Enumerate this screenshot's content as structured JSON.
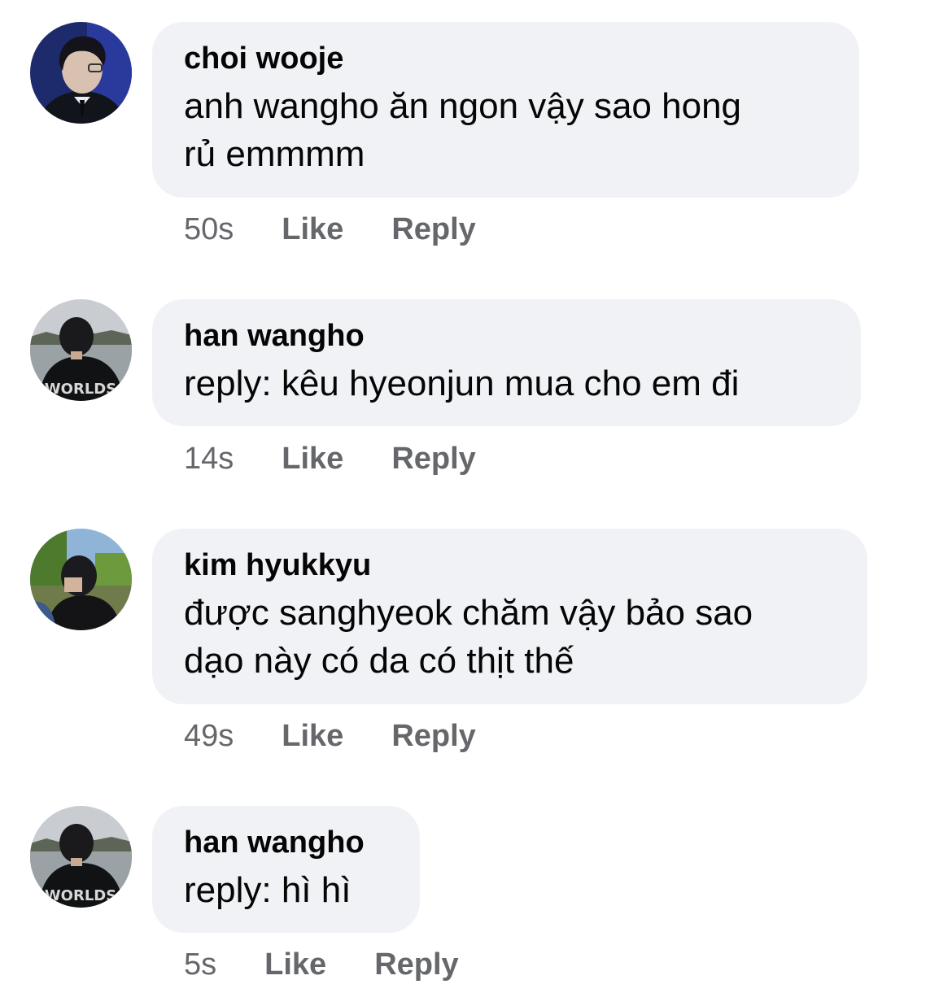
{
  "comments": [
    {
      "author": "choi wooje",
      "text_lines": [
        "anh wangho ăn ngon vậy sao hong",
        "rủ emmmm"
      ],
      "time": "50s",
      "like_label": "Like",
      "reply_label": "Reply",
      "avatar_icon": "profile-photo-man-in-suit"
    },
    {
      "author": "han wangho",
      "text_lines": [
        "reply: kêu hyeonjun mua cho em đi"
      ],
      "time": "14s",
      "like_label": "Like",
      "reply_label": "Reply",
      "avatar_icon": "profile-photo-back-view-worlds-jacket",
      "avatar_text": "WORLDS"
    },
    {
      "author": "kim hyukkyu",
      "text_lines": [
        "được sanghyeok chăm vậy bảo sao",
        "dạo này có da có thịt thế"
      ],
      "time": "49s",
      "like_label": "Like",
      "reply_label": "Reply",
      "avatar_icon": "profile-photo-outdoor-trees"
    },
    {
      "author": "han wangho",
      "text_lines": [
        "reply: hì hì"
      ],
      "time": "5s",
      "like_label": "Like",
      "reply_label": "Reply",
      "avatar_icon": "profile-photo-back-view-worlds-jacket",
      "avatar_text": "WORLDS"
    }
  ],
  "colors": {
    "bubble_bg": "#f0f2f5",
    "author_text": "#050505",
    "meta_text": "#65676b",
    "background": "#ffffff"
  }
}
